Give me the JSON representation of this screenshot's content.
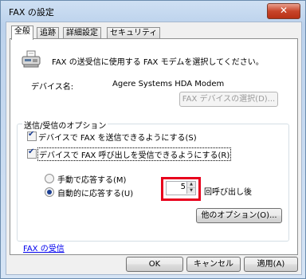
{
  "window": {
    "title": "FAX の設定",
    "close_glyph": "✕"
  },
  "tabs": [
    {
      "label": "全般"
    },
    {
      "label": "追跡"
    },
    {
      "label": "詳細設定"
    },
    {
      "label": "セキュリティ"
    }
  ],
  "general": {
    "description": "FAX の送受信に使用する FAX モデムを選択してください。",
    "device_label": "デバイス名:",
    "device_value": "Agere Systems HDA Modem",
    "select_device_button": "FAX デバイスの選択(D)...",
    "options_group": "送信/受信のオプション",
    "send_checkbox": "デバイスで FAX を送信できるようにする(S)",
    "receive_checkbox": "デバイスで FAX 呼び出しを受信できるようにする(R)",
    "manual_radio": "手動で応答する(M)",
    "auto_radio": "自動的に応答する(U)",
    "rings_value": "5",
    "rings_suffix": "回呼び出し後",
    "more_options_button": "他のオプション(O)...",
    "fax_receive_link": "FAX の受信"
  },
  "footer": {
    "ok": "OK",
    "cancel": "キャンセル",
    "apply": "適用(A)"
  },
  "colors": {
    "highlight": "#e8001c",
    "link": "#0000ee"
  }
}
